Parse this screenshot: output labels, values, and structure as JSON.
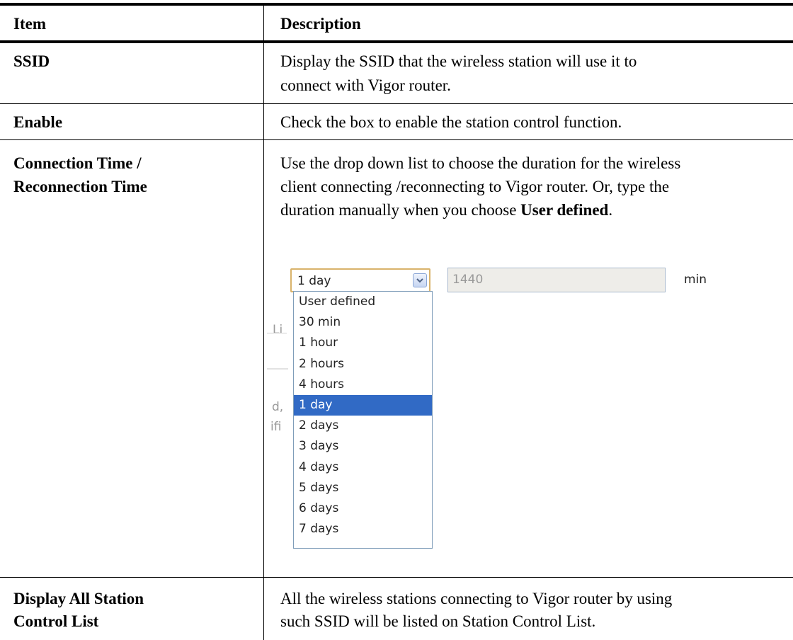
{
  "table": {
    "headers": {
      "item": "Item",
      "description": "Description"
    },
    "rows": [
      {
        "item": "SSID",
        "description": [
          "Display the SSID that the wireless station will use it to",
          "connect with Vigor router."
        ]
      },
      {
        "item": "Enable",
        "description": [
          "Check the box to enable the station control function."
        ]
      },
      {
        "item": [
          "Connection Time /",
          "Reconnection Time"
        ],
        "description_line1": "Use the drop down list to choose the duration for the wireless",
        "description_line2": "client connecting /reconnecting to Vigor router. Or, type the",
        "description_line3_prefix": "duration manually when you choose ",
        "description_line3_bold": "User defined",
        "description_line3_suffix": "."
      },
      {
        "item": [
          "Display All Station",
          "Control List"
        ],
        "description": [
          "All the wireless stations connecting to Vigor router by using",
          "such SSID will be listed on Station Control List."
        ]
      }
    ]
  },
  "screenshot": {
    "select_value": "1 day",
    "input_value": "1440",
    "unit_label": "min",
    "options": [
      "User defined",
      "30 min",
      "1 hour",
      "2 hours",
      "4 hours",
      "1 day",
      "2 days",
      "3 days",
      "4 days",
      "5 days",
      "6 days",
      "7 days"
    ],
    "selected_option": "1 day",
    "ghost_text": [
      "Li",
      "d,",
      "ifi"
    ],
    "colors": {
      "highlight": "#316ac5",
      "field_bg": "#eeede9",
      "focus_border": "#d9b36b"
    }
  }
}
